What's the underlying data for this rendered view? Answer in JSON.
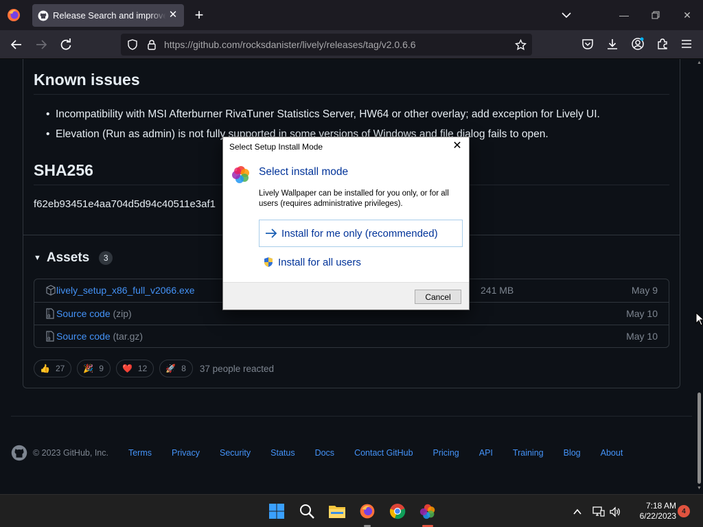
{
  "browser": {
    "tab_title": "Release Search and improveme",
    "url_host": "https://github.com",
    "url_path": "/rocksdanister/lively/releases/tag/v2.0.6.6"
  },
  "page": {
    "known_issues_heading": "Known issues",
    "known_issues": [
      "Incompatibility with MSI Afterburner RivaTuner Statistics Server, HW64 or other overlay; add exception for Lively UI.",
      "Elevation (Run as admin) is not fully supported in some versions of Windows and file dialog fails to open."
    ],
    "sha_heading": "SHA256",
    "sha_value": "f62eb93451e4aa704d5d94c40511e3af1",
    "assets": {
      "label": "Assets",
      "count": "3",
      "rows": [
        {
          "name": "lively_setup_x86_full_v2066.exe",
          "suffix": "",
          "size": "241 MB",
          "date": "May 9"
        },
        {
          "name": "Source code",
          "suffix": "(zip)",
          "size": "",
          "date": "May 10"
        },
        {
          "name": "Source code",
          "suffix": "(tar.gz)",
          "size": "",
          "date": "May 10"
        }
      ]
    },
    "reactions": [
      {
        "emoji": "👍",
        "count": "27"
      },
      {
        "emoji": "🎉",
        "count": "9"
      },
      {
        "emoji": "❤️",
        "count": "12"
      },
      {
        "emoji": "🚀",
        "count": "8"
      }
    ],
    "reactions_total": "37 people reacted"
  },
  "footer": {
    "copyright": "© 2023 GitHub, Inc.",
    "links": [
      "Terms",
      "Privacy",
      "Security",
      "Status",
      "Docs",
      "Contact GitHub",
      "Pricing",
      "API",
      "Training",
      "Blog",
      "About"
    ]
  },
  "dialog": {
    "title": "Select Setup Install Mode",
    "heading": "Select install mode",
    "description": "Lively Wallpaper can be installed for you only, or for all users (requires administrative privileges).",
    "option_me": "Install for me only (recommended)",
    "option_all": "Install for all users",
    "cancel": "Cancel"
  },
  "taskbar": {
    "time": "7:18 AM",
    "date": "6/22/2023",
    "notifications": "4"
  },
  "colors": {
    "link": "#4493f8",
    "dialog_link": "#003399",
    "bg": "#0d1117"
  },
  "icons": [
    "firefox-icon",
    "github-icon",
    "close-icon",
    "plus-icon",
    "back-icon",
    "forward-icon",
    "reload-icon",
    "shield-icon",
    "lock-icon",
    "star-icon",
    "pocket-icon",
    "download-icon",
    "account-icon",
    "extensions-icon",
    "menu-icon",
    "package-icon",
    "file-zip-icon",
    "windows-start-icon",
    "search-icon",
    "file-explorer-icon",
    "chrome-icon",
    "lively-icon"
  ]
}
